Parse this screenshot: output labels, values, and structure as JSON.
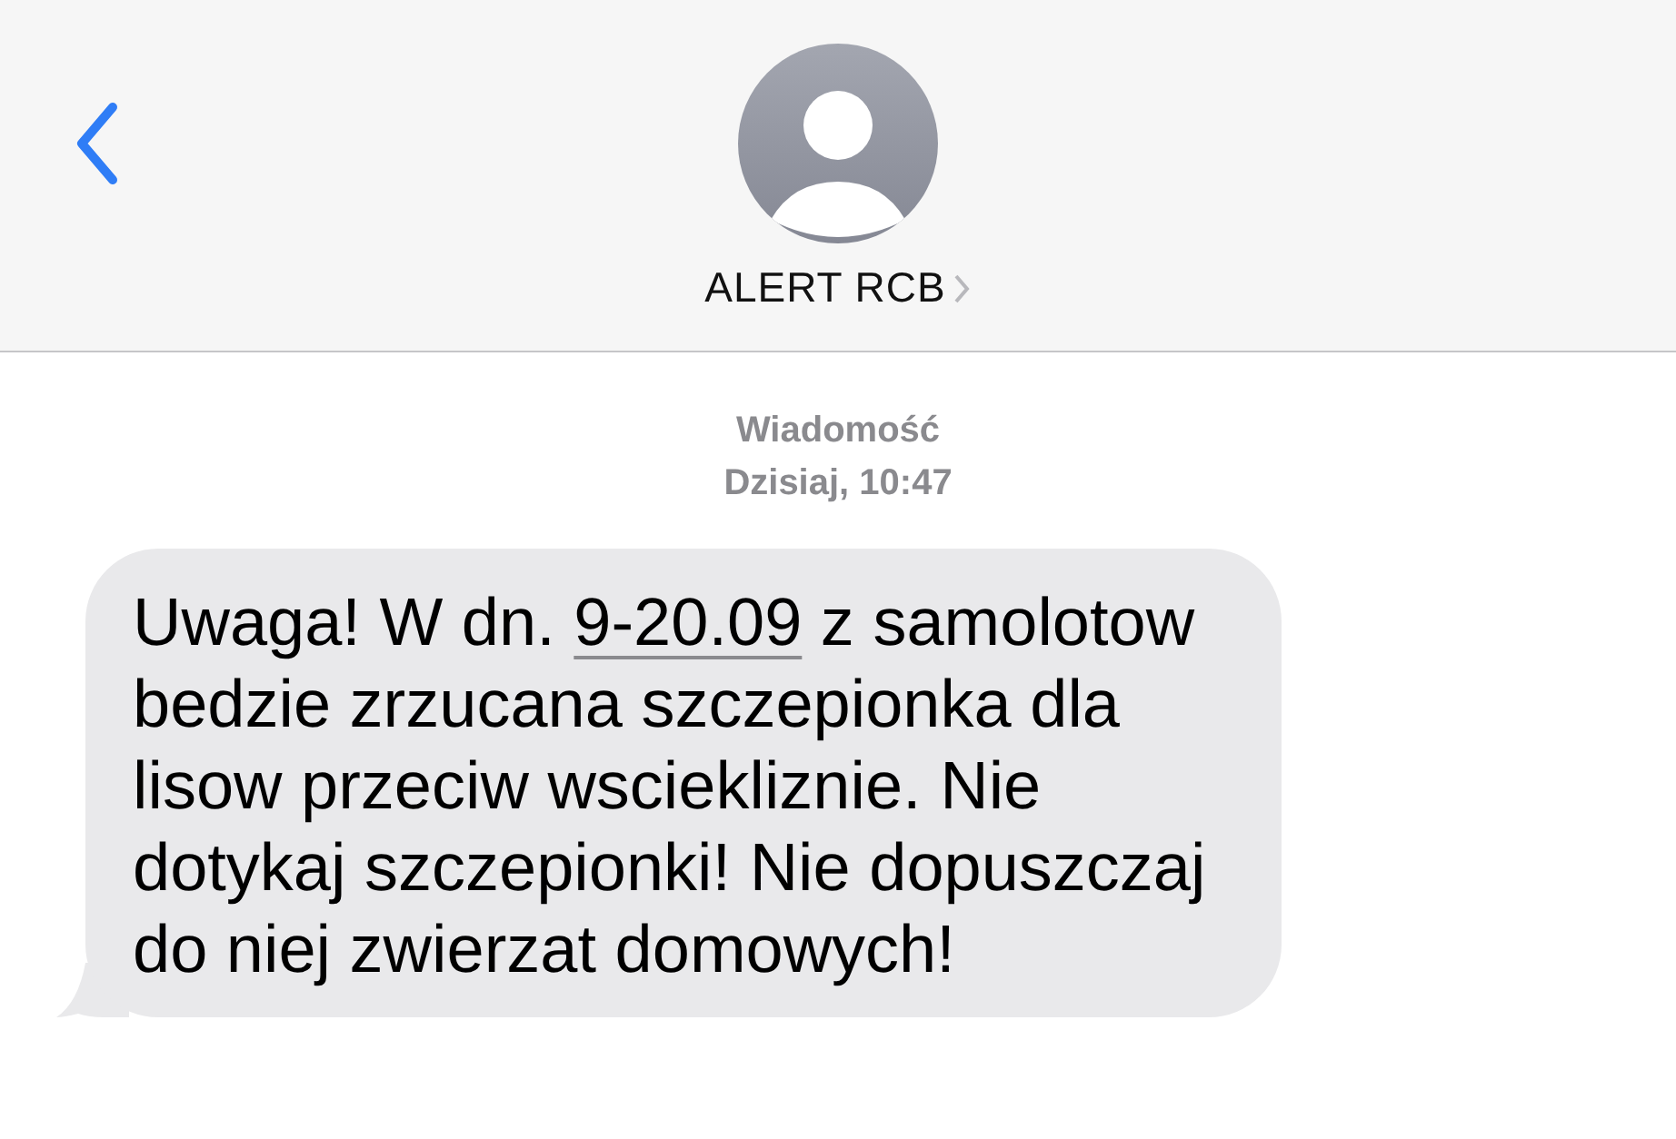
{
  "header": {
    "contact_name": "ALERT RCB"
  },
  "thread": {
    "label": "Wiadomość",
    "timestamp": "Dzisiaj, 10:47"
  },
  "messages": [
    {
      "parts": [
        {
          "kind": "text",
          "text": "Uwaga! W dn. "
        },
        {
          "kind": "link",
          "text": "9-20.09"
        },
        {
          "kind": "text",
          "text": " z samolotow bedzie zrzucana szczepionka dla lisow przeciw wsciekliznie. Nie dotykaj szczepionki! Nie dopuszczaj do niej zwierzat domowych!"
        }
      ]
    }
  ]
}
